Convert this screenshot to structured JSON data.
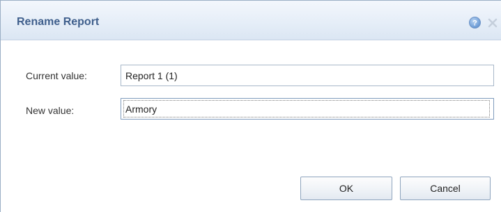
{
  "dialog": {
    "title": "Rename Report",
    "help_icon": "help-icon",
    "close_icon": "close-icon"
  },
  "fields": {
    "current": {
      "label": "Current value:",
      "value": "Report 1 (1)",
      "read_only": true
    },
    "new": {
      "label": "New value:",
      "value": "Armory"
    }
  },
  "buttons": {
    "ok_label": "OK",
    "cancel_label": "Cancel"
  },
  "colors": {
    "title_text": "#3f5f8c",
    "titlebar_bg": "#e6eef8",
    "help_icon": "#5a8fd0",
    "close_icon": "#c5cfdc",
    "input_border": "#a7b7c9"
  }
}
